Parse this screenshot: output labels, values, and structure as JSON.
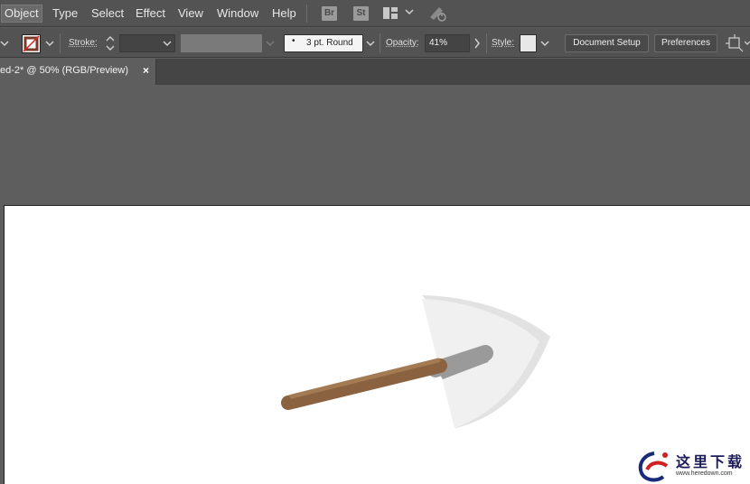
{
  "menu": {
    "items": [
      "Object",
      "Type",
      "Select",
      "Effect",
      "View",
      "Window",
      "Help"
    ],
    "active": "Object",
    "bridge_badge": "Br",
    "stock_badge": "St"
  },
  "control_bar": {
    "stroke_label": "Stroke:",
    "brush_value": "3 pt. Round",
    "opacity_label": "Opacity:",
    "opacity_value": "41%",
    "style_label": "Style:",
    "document_setup_label": "Document Setup",
    "preferences_label": "Preferences"
  },
  "tab": {
    "title": "ed-2* @ 50% (RGB/Preview)",
    "close_glyph": "×"
  },
  "artwork": {
    "handle_color": "#8a6240",
    "handle_highlight": "#a47a52",
    "ferrule_color": "#9a9a9a",
    "blade_color": "#f0f0f0",
    "blade_shadow": "#e2e2e2"
  },
  "watermark": {
    "text": "这里下载",
    "url": "www.heredown.com"
  }
}
